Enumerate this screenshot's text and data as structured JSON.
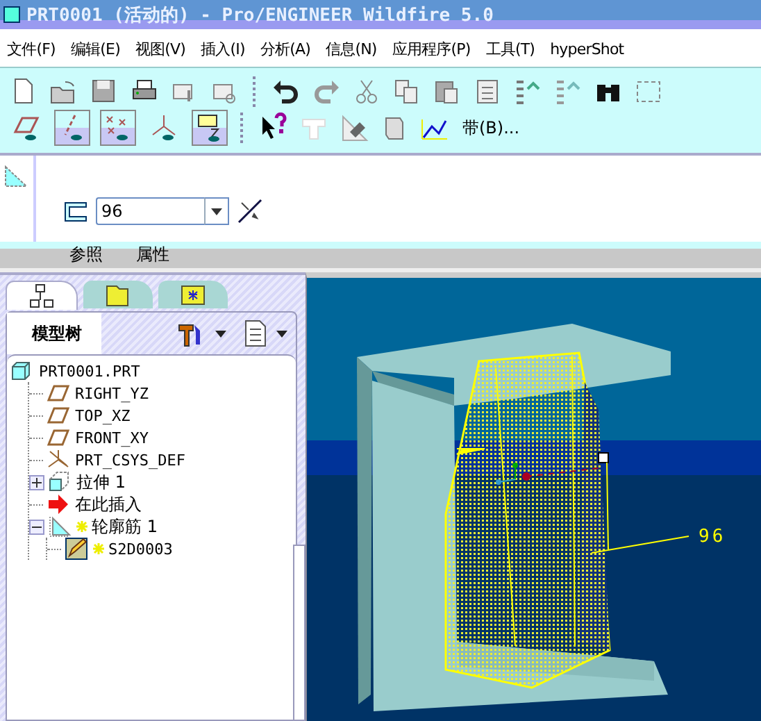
{
  "window": {
    "title": "PRT0001 (活动的) - Pro/ENGINEER Wildfire 5.0"
  },
  "menu": [
    "文件(F)",
    "编辑(E)",
    "视图(V)",
    "插入(I)",
    "分析(A)",
    "信息(N)",
    "应用程序(P)",
    "工具(T)",
    "hyperShot"
  ],
  "display_toggles": [
    {
      "on": false
    },
    {
      "on": true
    },
    {
      "on": true
    },
    {
      "on": false
    },
    {
      "on": true
    }
  ],
  "toolbar_text_button": "带(B)...",
  "dashboard": {
    "thickness": "96",
    "tabs": [
      {
        "label": "参照",
        "selected": false
      },
      {
        "label": "属性",
        "selected": false
      }
    ]
  },
  "navigator": {
    "tabs": [
      {
        "selected": true
      },
      {
        "selected": false
      },
      {
        "selected": false
      }
    ],
    "title": "模型树",
    "tree": [
      {
        "label": "PRT0001.PRT",
        "kind": "part",
        "new": false,
        "children": [
          {
            "label": "RIGHT_YZ",
            "kind": "plane",
            "new": false
          },
          {
            "label": "TOP_XZ",
            "kind": "plane",
            "new": false
          },
          {
            "label": "FRONT_XY",
            "kind": "plane",
            "new": false
          },
          {
            "label": "PRT_CSYS_DEF",
            "kind": "csys",
            "new": false
          },
          {
            "label": "拉伸 1",
            "kind": "extrude",
            "new": false,
            "expanded": false
          },
          {
            "label": "在此插入",
            "kind": "insert",
            "new": false
          },
          {
            "label": "轮廓筋 1",
            "kind": "rib",
            "new": true,
            "expanded": true,
            "children": [
              {
                "label": "S2D0003",
                "kind": "sketch",
                "new": true
              }
            ]
          }
        ]
      }
    ]
  },
  "viewport": {
    "dimension": "96"
  }
}
